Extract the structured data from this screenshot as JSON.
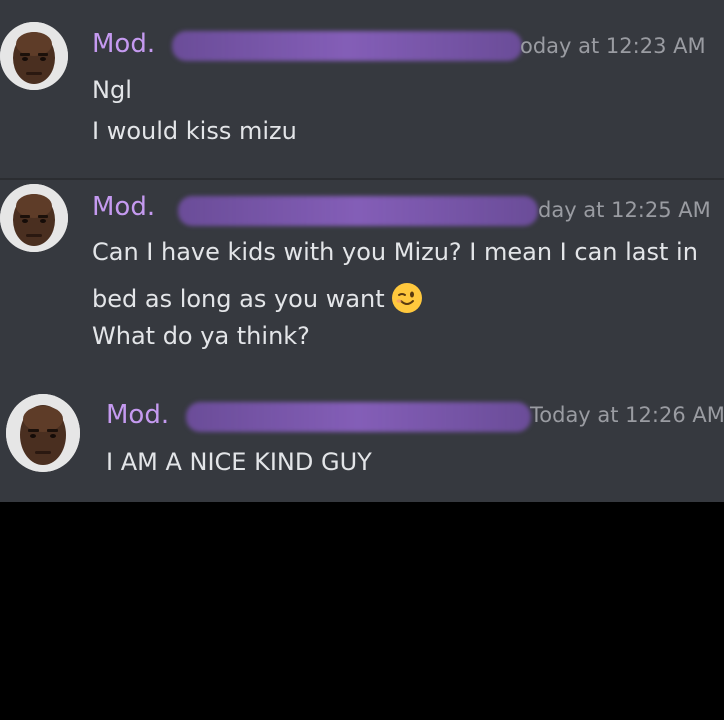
{
  "messages": [
    {
      "username": "Mod.",
      "timestamp": "oday at 12:23 AM",
      "lines": [
        "Ngl",
        "I would kiss mizu"
      ],
      "avatar_icon": "person-avatar-icon"
    },
    {
      "username": "Mod.",
      "timestamp": "day at 12:25 AM",
      "lines": [
        "Can I have kids with you Mizu? I mean I can last in",
        "bed as long as you want",
        "What do ya think?"
      ],
      "emoji": "winking-face-emoji",
      "avatar_icon": "person-avatar-icon"
    },
    {
      "username": "Mod.",
      "timestamp": "Today at 12:26 AM",
      "lines": [
        "I AM A NICE KIND GUY"
      ],
      "avatar_icon": "person-avatar-icon"
    }
  ],
  "colors": {
    "background": "#36393f",
    "username": "#c59af0",
    "message_text": "#e3e5e8",
    "timestamp": "#9a9ca2",
    "redaction": "#7c56b4",
    "outer": "#000000"
  }
}
